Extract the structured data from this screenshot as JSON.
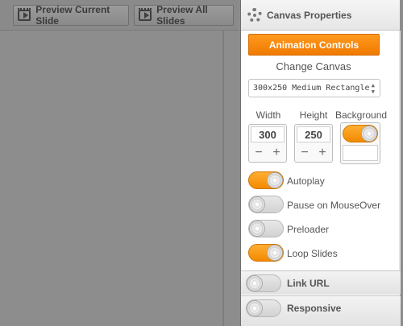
{
  "toolbar": {
    "preview_current_label": "Preview Current Slide",
    "preview_all_label": "Preview All Slides"
  },
  "panel": {
    "title": "Canvas Properties",
    "animation_controls_label": "Animation Controls",
    "change_canvas_label": "Change Canvas",
    "canvas_select_value": "300x250 Medium Rectangle",
    "width_label": "Width",
    "height_label": "Height",
    "background_label": "Background",
    "width_value": "300",
    "height_value": "250",
    "minus_glyph": "−",
    "plus_glyph": "+",
    "select_arrows": "▲\n▼",
    "options": [
      {
        "label": "Autoplay",
        "on": true
      },
      {
        "label": "Pause on MouseOver",
        "on": false
      },
      {
        "label": "Preloader",
        "on": false
      },
      {
        "label": "Loop Slides",
        "on": true
      }
    ],
    "sections": [
      {
        "label": "Link URL",
        "on": false
      },
      {
        "label": "Responsive",
        "on": false
      }
    ],
    "background_toggle_on": true
  },
  "colors": {
    "accent": "#f28a00",
    "stage": "#8d8d8d"
  },
  "icons": {
    "preview_icon": "film-play-icon",
    "settings_icon": "gear-icon"
  }
}
